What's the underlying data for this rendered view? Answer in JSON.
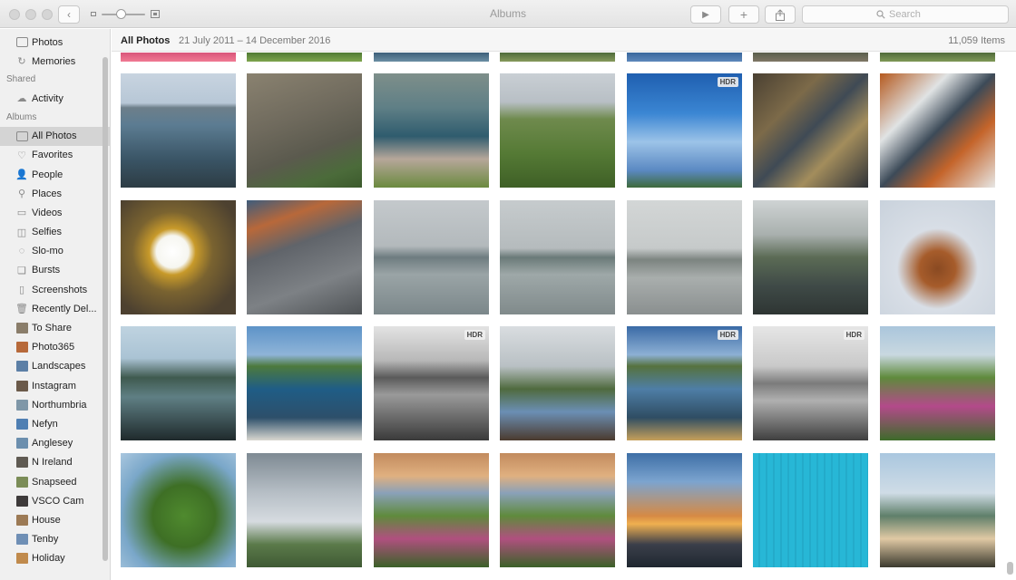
{
  "window": {
    "title": "Albums"
  },
  "toolbar": {
    "back": "‹",
    "play": "▶",
    "add": "+",
    "share": "⇪"
  },
  "search": {
    "placeholder": "Search"
  },
  "sidebar": {
    "library_items": [
      {
        "label": "Photos",
        "icon": "photos-icon"
      },
      {
        "label": "Memories",
        "icon": "memories-icon"
      }
    ],
    "shared_title": "Shared",
    "shared_items": [
      {
        "label": "Activity",
        "icon": "activity-icon"
      }
    ],
    "albums_title": "Albums",
    "album_items": [
      {
        "label": "All Photos",
        "icon": "all-photos-icon",
        "selected": true
      },
      {
        "label": "Favorites",
        "icon": "heart-icon"
      },
      {
        "label": "People",
        "icon": "person-icon"
      },
      {
        "label": "Places",
        "icon": "pin-icon"
      },
      {
        "label": "Videos",
        "icon": "video-icon"
      },
      {
        "label": "Selfies",
        "icon": "selfie-icon"
      },
      {
        "label": "Slo-mo",
        "icon": "slomo-icon"
      },
      {
        "label": "Bursts",
        "icon": "bursts-icon"
      },
      {
        "label": "Screenshots",
        "icon": "screenshot-icon"
      },
      {
        "label": "Recently Del...",
        "icon": "trash-icon"
      },
      {
        "label": "To Share",
        "icon": "album-thumb-icon",
        "color": "#8a7d6a"
      },
      {
        "label": "Photo365",
        "icon": "album-thumb-icon",
        "color": "#b7693a"
      },
      {
        "label": "Landscapes",
        "icon": "album-thumb-icon",
        "color": "#5c7fa6"
      },
      {
        "label": "Instagram",
        "icon": "album-thumb-icon",
        "color": "#6b5a4a"
      },
      {
        "label": "Northumbria",
        "icon": "album-thumb-icon",
        "color": "#7f97a8"
      },
      {
        "label": "Nefyn",
        "icon": "album-thumb-icon",
        "color": "#4f7fb3"
      },
      {
        "label": "Anglesey",
        "icon": "album-thumb-icon",
        "color": "#6c8fae"
      },
      {
        "label": "N Ireland",
        "icon": "album-thumb-icon",
        "color": "#5f5a52"
      },
      {
        "label": "Snapseed",
        "icon": "album-thumb-icon",
        "color": "#7b8c57"
      },
      {
        "label": "VSCO Cam",
        "icon": "album-thumb-icon",
        "color": "#3e3a3a"
      },
      {
        "label": "House",
        "icon": "album-thumb-icon",
        "color": "#9c7a55"
      },
      {
        "label": "Tenby",
        "icon": "album-thumb-icon",
        "color": "#6f8fb5"
      },
      {
        "label": "Holiday",
        "icon": "album-thumb-icon",
        "color": "#c08a4c"
      }
    ]
  },
  "header": {
    "title": "All Photos",
    "date_range": "21 July 2011 – 14 December 2016",
    "count": "11,059 Items"
  },
  "grid": {
    "top_row": [
      {
        "bg": "linear-gradient(180deg,#d9547a,#f07a93)"
      },
      {
        "bg": "linear-gradient(180deg,#4f7a34,#7ea44d)"
      },
      {
        "bg": "linear-gradient(180deg,#3d5f7a,#6b8ea3)"
      },
      {
        "bg": "linear-gradient(180deg,#4e6b3b,#86995c)"
      },
      {
        "bg": "linear-gradient(180deg,#39679d,#5d88bb)"
      },
      {
        "bg": "linear-gradient(180deg,#5a5f4d,#7f7766)"
      },
      {
        "bg": "linear-gradient(180deg,#4f6a3a,#7f9857)"
      }
    ],
    "rows": [
      [
        {
          "hdr": false,
          "bg": "linear-gradient(180deg,#c8d4e0 0%,#b7c7d6 26%,#6d7f8a 30%,#5c7c92 45%,#3a5566 75%,#2d3c44 100%)"
        },
        {
          "hdr": false,
          "bg": "linear-gradient(160deg,#8a8270 0%,#6f6a5d 40%,#5b5a4e 65%,#4b6b3a 85%,#3c5a2c 100%)"
        },
        {
          "hdr": false,
          "bg": "linear-gradient(180deg,#7e8f8a 0%,#5f7f86 30%,#2f5c6e 55%,#b6a79a 75%,#6b8a3f 100%)"
        },
        {
          "hdr": false,
          "bg": "linear-gradient(180deg,#c9cfd4 0%,#b8bfc5 25%,#6f8a4d 40%,#557a35 70%,#3e5f26 100%)"
        },
        {
          "hdr": true,
          "bg": "linear-gradient(180deg,#1f5fb0 0%,#3b86d3 35%,#9cc3e8 60%,#5b89c2 85%,#3e6a3b 100%)"
        },
        {
          "hdr": false,
          "bg": "linear-gradient(135deg,#4a4032 0%,#7c6a49 30%,#3f4a55 50%,#a38d5c 70%,#2f3238 100%)"
        },
        {
          "hdr": false,
          "bg": "linear-gradient(135deg,#b55a1f 0%,#e0e3e4 30%,#3c4a58 50%,#c4642a 70%,#e7e7e5 100%)"
        }
      ],
      [
        {
          "hdr": false,
          "bg": "radial-gradient(circle at 45% 45%,#ffffff 0%,#f6f6f0 18%,#c89a2a 26%,#7a6330 45%,#4d4130 80%)"
        },
        {
          "hdr": false,
          "bg": "linear-gradient(160deg,#3e5c7c 0%,#b8683a 20%,#60646a 40%,#7d8185 70%,#4f5356 100%)"
        },
        {
          "hdr": false,
          "bg": "linear-gradient(180deg,#c4c9cc 0%,#b3b9bc 40%,#6e7c80 50%,#9aa4a6 65%,#7b878a 100%)"
        },
        {
          "hdr": false,
          "bg": "linear-gradient(180deg,#c6cbcd 0%,#b5bbbd 42%,#6a7a78 50%,#9ea8a8 65%,#808a8b 100%)"
        },
        {
          "hdr": false,
          "bg": "linear-gradient(180deg,#d3d6d6 0%,#c6caca 42%,#7c8480 52%,#a9aead 68%,#8a8f8f 100%)"
        },
        {
          "hdr": false,
          "bg": "linear-gradient(180deg,#cfd3d4 0%,#a9b0ae 30%,#5b6b55 50%,#3f4a47 75%,#2e3533 100%)"
        },
        {
          "hdr": false,
          "bg": "radial-gradient(circle at 50% 60%,#8a4a22 0%,#a65c2b 20%,#d8dee6 45%,#c9d2dc 100%)"
        }
      ],
      [
        {
          "hdr": false,
          "bg": "linear-gradient(180deg,#bfd3e0 0%,#aac3d4 28%,#3f5a4f 45%,#5f7f84 62%,#1f2a2c 100%)"
        },
        {
          "hdr": false,
          "bg": "linear-gradient(180deg,#5d93c8 0%,#8fb4d8 25%,#4d7a3d 35%,#1f5d86 55%,#2d4f6a 80%,#d9d7d0 100%)"
        },
        {
          "hdr": true,
          "bg": "linear-gradient(180deg,#e3e3e3 0%,#b8b8b8 30%,#5a5a5a 45%,#9a9a9a 60%,#3a3a3a 100%)"
        },
        {
          "hdr": false,
          "bg": "linear-gradient(180deg,#d9dde0 0%,#b9c0c4 35%,#4f6a3e 55%,#6b8fb4 75%,#4b3a2e 100%)"
        },
        {
          "hdr": true,
          "bg": "linear-gradient(180deg,#3a6aa6 0%,#8db0d4 25%,#56723e 35%,#4e7ea6 55%,#2f4d63 80%,#c6a05a 100%)"
        },
        {
          "hdr": true,
          "bg": "linear-gradient(180deg,#e6e6e6 0%,#c9c9c9 35%,#7b7b7b 50%,#b0b0b0 65%,#3f3f3f 100%)"
        },
        {
          "hdr": false,
          "bg": "linear-gradient(180deg,#aac6dc 0%,#c9d8e0 25%,#5f8a3c 45%,#b34a8a 70%,#3d6b2a 100%)"
        }
      ],
      [
        {
          "hdr": false,
          "bg": "radial-gradient(circle at 55% 55%,#4f8a2e 0%,#3e6f25 35%,#7aa7c9 70%,#a9c7df 100%)"
        },
        {
          "hdr": false,
          "bg": "linear-gradient(180deg,#7e8a93 0%,#b7bfc6 35%,#d6dbe0 60%,#5b7a4a 80%,#3f5a34 100%)"
        },
        {
          "hdr": false,
          "bg": "linear-gradient(180deg,#c28b5e 0%,#e0b080 20%,#8aa1b9 35%,#5f8a3c 55%,#b0507f 75%,#3b6128 100%)"
        },
        {
          "hdr": false,
          "bg": "linear-gradient(180deg,#c28b5e 0%,#e0b080 20%,#8aa1b9 35%,#5f8a3c 55%,#b0507f 75%,#3b6128 100%)"
        },
        {
          "hdr": false,
          "bg": "linear-gradient(180deg,#3e6fa6 0%,#7ca4cf 25%,#d68a44 55%,#f0b050 62%,#3b3f4a 80%,#1f2730 100%)"
        },
        {
          "hdr": false,
          "bg": "repeating-linear-gradient(90deg,#27b7d6 0px,#27b7d6 6px,#1f9fbd 7px,#27b7d6 8px)"
        },
        {
          "hdr": false,
          "bg": "linear-gradient(180deg,#aac7df 0%,#cfdce6 35%,#5f7f6a 55%,#e0c9a4 75%,#3b3a2e 100%)"
        }
      ]
    ]
  },
  "badges": {
    "hdr": "HDR"
  },
  "colors": {
    "sidebar_bg": "#f0f0f0",
    "selection": "#d4d4d4",
    "titlebar": "#e9e9e9"
  }
}
